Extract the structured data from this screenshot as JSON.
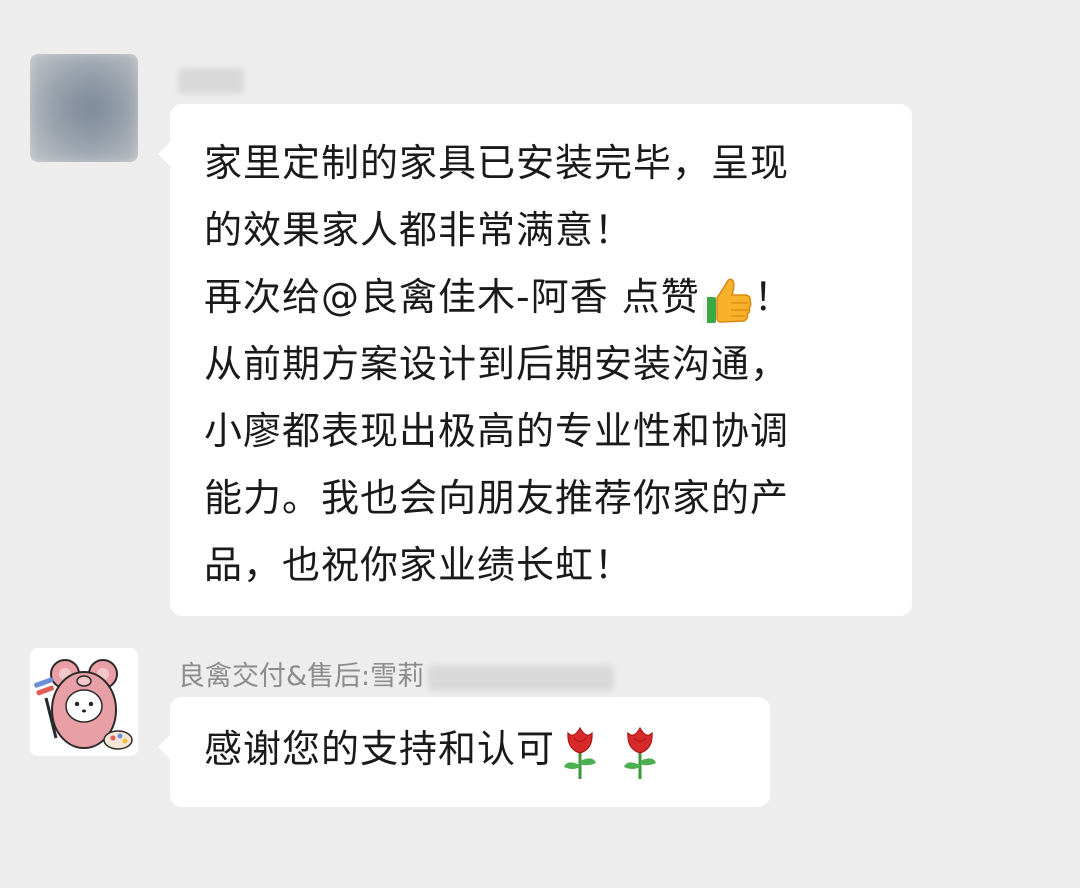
{
  "messages": [
    {
      "sender_name": "",
      "avatar": "blurred-avatar",
      "lines": [
        "家里定制的家具已安装完毕，呈现",
        "的效果家人都非常满意！",
        "再次给@良禽佳木-阿香  点赞",
        "！",
        "从前期方案设计到后期安装沟通，",
        "小廖都表现出极高的专业性和协调",
        "能力。我也会向朋友推荐你家的产",
        "品，也祝你家业绩长虹！"
      ],
      "emoji": "thumbs-up"
    },
    {
      "sender_name": "良禽交付&售后:雪莉",
      "avatar": "pink-bear-painter",
      "text": "感谢您的支持和认可",
      "emoji": "rose"
    }
  ],
  "colors": {
    "background": "#ededed",
    "bubble": "#ffffff",
    "sender": "#8c8c8c",
    "text": "#1a1a1a"
  }
}
